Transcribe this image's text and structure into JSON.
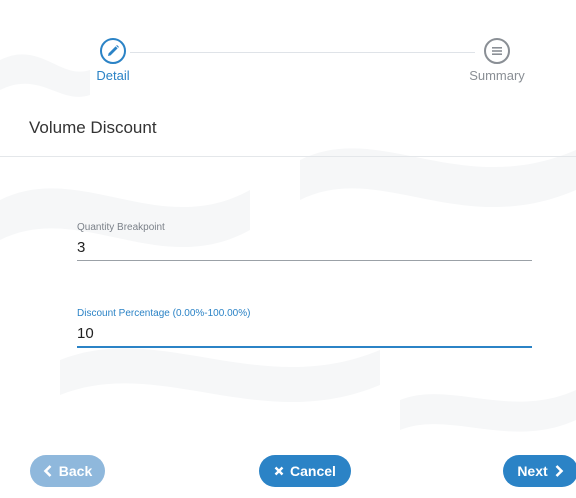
{
  "stepper": {
    "steps": [
      {
        "label": "Detail",
        "icon": "pencil-icon",
        "state": "active"
      },
      {
        "label": "Summary",
        "icon": "list-icon",
        "state": "inactive"
      }
    ]
  },
  "section": {
    "title": "Volume Discount"
  },
  "form": {
    "quantity": {
      "label": "Quantity Breakpoint",
      "value": "3"
    },
    "discount": {
      "label": "Discount Percentage (0.00%-100.00%)",
      "value": "10"
    }
  },
  "actions": {
    "back_label": "Back",
    "cancel_label": "Cancel",
    "next_label": "Next"
  },
  "colors": {
    "accent": "#2b83c6",
    "accent_disabled": "#8fb8dc",
    "inactive": "#8a8f95"
  }
}
